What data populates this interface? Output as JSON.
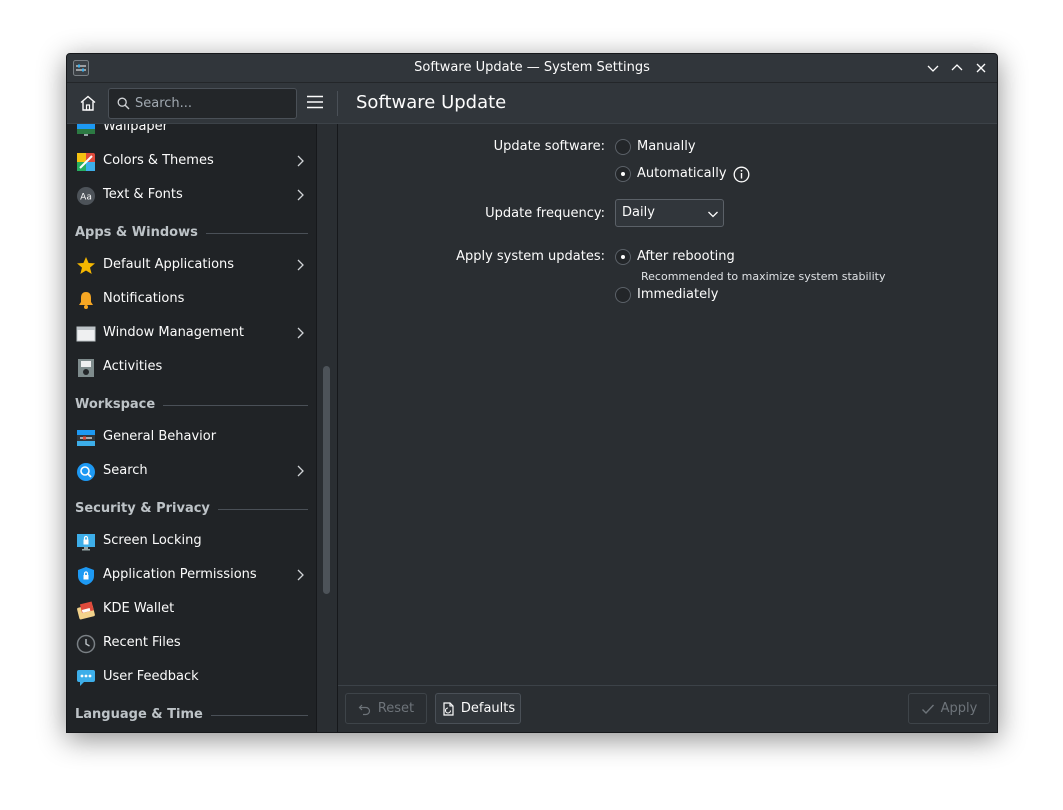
{
  "window": {
    "title": "Software Update — System Settings"
  },
  "toolbar": {
    "search_placeholder": "Search...",
    "page_title": "Software Update"
  },
  "sidebar": {
    "items": [
      {
        "label": "Wallpaper",
        "icon": "wallpaper-icon"
      },
      {
        "label": "Colors & Themes",
        "icon": "colors-icon",
        "has_submenu": true
      },
      {
        "label": "Text & Fonts",
        "icon": "fonts-icon",
        "has_submenu": true
      }
    ],
    "sections": [
      {
        "header": "Apps & Windows",
        "items": [
          {
            "label": "Default Applications",
            "icon": "star-icon",
            "has_submenu": true
          },
          {
            "label": "Notifications",
            "icon": "bell-icon"
          },
          {
            "label": "Window Management",
            "icon": "window-icon",
            "has_submenu": true
          },
          {
            "label": "Activities",
            "icon": "activities-icon"
          }
        ]
      },
      {
        "header": "Workspace",
        "items": [
          {
            "label": "General Behavior",
            "icon": "general-behavior-icon"
          },
          {
            "label": "Search",
            "icon": "search-icon",
            "has_submenu": true
          }
        ]
      },
      {
        "header": "Security & Privacy",
        "items": [
          {
            "label": "Screen Locking",
            "icon": "screen-lock-icon"
          },
          {
            "label": "Application Permissions",
            "icon": "shield-icon",
            "has_submenu": true
          },
          {
            "label": "KDE Wallet",
            "icon": "wallet-icon"
          },
          {
            "label": "Recent Files",
            "icon": "clock-icon"
          },
          {
            "label": "User Feedback",
            "icon": "feedback-icon"
          }
        ]
      },
      {
        "header": "Language & Time",
        "items": []
      }
    ]
  },
  "content": {
    "update_software": {
      "label": "Update software:",
      "options": [
        "Manually",
        "Automatically"
      ],
      "selected": "Automatically"
    },
    "update_frequency": {
      "label": "Update frequency:",
      "value": "Daily"
    },
    "apply_updates": {
      "label": "Apply system updates:",
      "options": [
        "After rebooting",
        "Immediately"
      ],
      "selected": "After rebooting",
      "hint": "Recommended to maximize system stability"
    }
  },
  "footer": {
    "reset_label": "Reset",
    "defaults_label": "Defaults",
    "apply_label": "Apply"
  },
  "colors": {
    "window_bg": "#2a2e32",
    "sidebar_bg": "#202326",
    "titlebar_bg": "#31363b",
    "text": "#fcfcfc"
  }
}
